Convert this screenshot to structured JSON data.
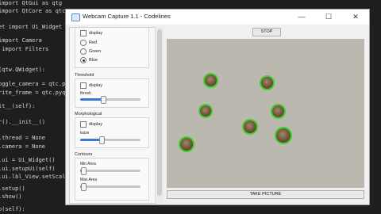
{
  "code": {
    "lines": [
      "import QtGui as qtg",
      "import QtCore as qtc",
      "",
      "et import Ui_Widget",
      "",
      "import Camera",
      " import Filters",
      "",
      "(qtw.QWidget):",
      "",
      "oggle_camera = qtc.py",
      "rite_frame = qtc.pyqt",
      "",
      "it__(self):",
      "",
      "r().__init__()",
      "",
      ".thread = None",
      ".camera = None",
      "",
      ".ui = Ui_Widget()",
      ".ui.setupUi(self)",
      ".ui.lbl_View.setScale",
      "",
      ".setup()",
      ".show()",
      "",
      "p(self):"
    ]
  },
  "window": {
    "title": "Webcam Capture 1.1 - Codelines",
    "minimize": "—",
    "maximize": "☐",
    "close": "✕"
  },
  "panel": {
    "color_options": [
      {
        "label": "display",
        "kind": "checkbox",
        "checked": false
      },
      {
        "label": "Red",
        "kind": "radio",
        "checked": false
      },
      {
        "label": "Green",
        "kind": "radio",
        "checked": false
      },
      {
        "label": "Blue",
        "kind": "radio",
        "checked": true
      }
    ],
    "threshold": {
      "title": "Threshold",
      "display_label": "display",
      "slider_label": "thresh",
      "value_fraction": 0.38
    },
    "morphological": {
      "title": "Morphological",
      "display_label": "display",
      "slider_label": "ksize",
      "value_fraction": 0.35
    },
    "contours": {
      "title": "Contours",
      "min_area_label": "Min Area",
      "min_area_fraction": 0.05,
      "max_area_label": "Max Area",
      "max_area_fraction": 0.05
    }
  },
  "buttons": {
    "stop": "STOP",
    "take_picture": "TAKE PICTURE"
  },
  "colors": {
    "contour_outline": "#3ed22e",
    "slider_fill": "#3b77d6",
    "camera_background": "#bbb8b0"
  }
}
